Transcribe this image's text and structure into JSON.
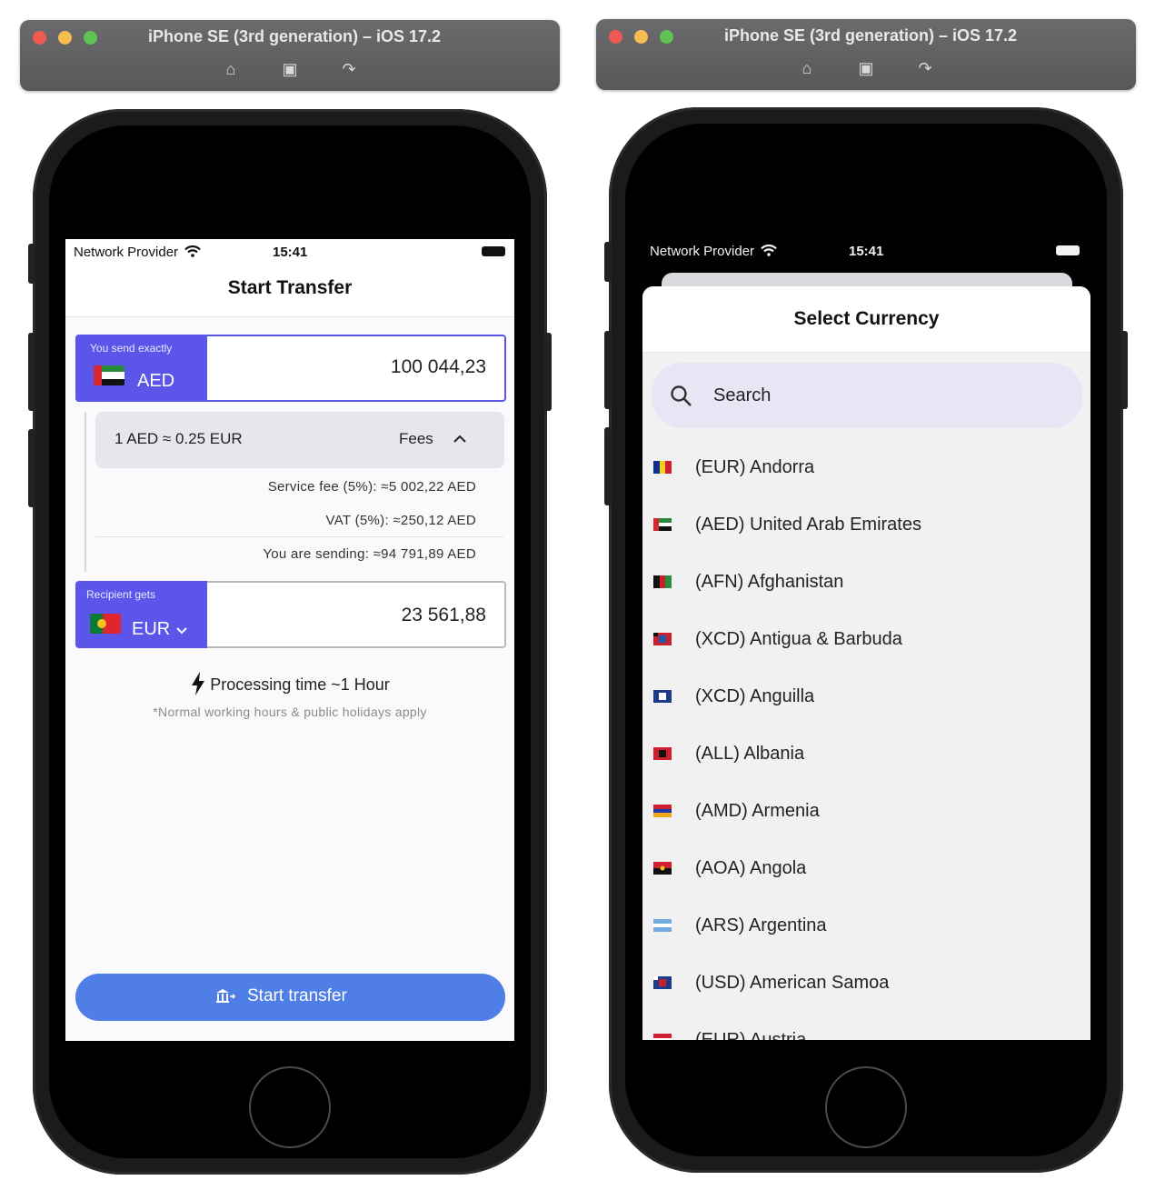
{
  "simulators": [
    {
      "title": "iPhone SE (3rd generation) – iOS 17.2",
      "icons": [
        "home-icon",
        "screenshot-icon",
        "rotate-icon"
      ]
    },
    {
      "title": "iPhone SE (3rd generation) – iOS 17.2",
      "icons": [
        "home-icon",
        "screenshot-icon",
        "rotate-icon"
      ]
    }
  ],
  "left": {
    "status": {
      "provider": "Network Provider",
      "time": "15:41"
    },
    "nav_title": "Start Transfer",
    "send": {
      "label": "You send exactly",
      "currency": "AED",
      "amount": "100 044,23"
    },
    "rate": "1 AED ≈ 0.25 EUR",
    "fees_label": "Fees",
    "fees": [
      "Service fee (5%): ≈5 002,22 AED",
      "VAT (5%): ≈250,12 AED",
      "You are sending: ≈94 791,89 AED"
    ],
    "receive": {
      "label": "Recipient gets",
      "currency": "EUR",
      "amount": "23 561,88"
    },
    "processing": "Processing time ~1 Hour",
    "note": "*Normal working hours & public holidays apply",
    "button": "Start transfer"
  },
  "right": {
    "status": {
      "provider": "Network Provider",
      "time": "15:41"
    },
    "sheet_title": "Select Currency",
    "search_placeholder": "Search",
    "currencies": [
      {
        "label": "(EUR) Andorra",
        "flag": "andorra"
      },
      {
        "label": "(AED) United Arab Emirates",
        "flag": "uae"
      },
      {
        "label": "(AFN) Afghanistan",
        "flag": "afghanistan"
      },
      {
        "label": "(XCD) Antigua & Barbuda",
        "flag": "antigua"
      },
      {
        "label": "(XCD) Anguilla",
        "flag": "anguilla"
      },
      {
        "label": "(ALL) Albania",
        "flag": "albania"
      },
      {
        "label": "(AMD) Armenia",
        "flag": "armenia"
      },
      {
        "label": "(AOA) Angola",
        "flag": "angola"
      },
      {
        "label": "(ARS) Argentina",
        "flag": "argentina"
      },
      {
        "label": "(USD) American Samoa",
        "flag": "american-samoa"
      },
      {
        "label": "(EUR) Austria",
        "flag": "austria"
      }
    ]
  },
  "colors": {
    "accent": "#5b55ea",
    "button": "#4f7ee6",
    "search_bg": "#e8e5f4"
  }
}
